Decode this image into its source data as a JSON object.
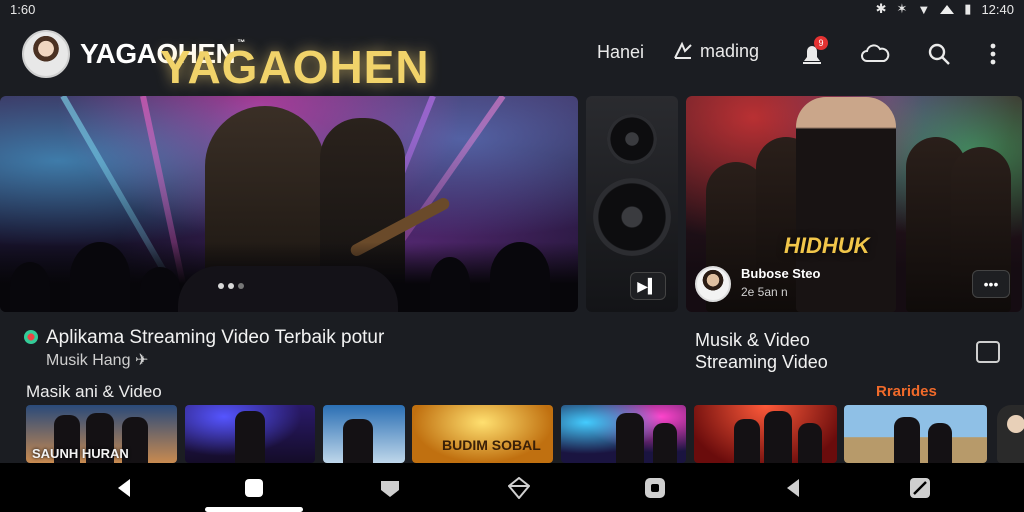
{
  "status_bar": {
    "time": "1:60",
    "clock": "12:40"
  },
  "header": {
    "brand": "YAGAOHEN",
    "trademark": "™",
    "nav_home": "Hanei",
    "nav_trending": "mading",
    "notification_count": "9"
  },
  "hero_main": {
    "title": "YAGAOHEN"
  },
  "hero_side": {
    "title": "HIDHUK",
    "channel_name": "Bubose Steo",
    "channel_sub": "2e 5an n"
  },
  "captions": {
    "main_title": "Aplikama Streaming Video Terbaik potur",
    "main_sub": "Musik Hang",
    "side_line1": "Musik & Video",
    "side_line2": "Streaming Video"
  },
  "row": {
    "title": "Masik ani & Video",
    "link": "Rrarides",
    "thumbs": [
      {
        "caption": "SAUNH HURAN"
      },
      {
        "caption": ""
      },
      {
        "caption": ""
      },
      {
        "caption": "BUDIM SOBAL"
      },
      {
        "caption": ""
      },
      {
        "caption": ""
      },
      {
        "caption": ""
      }
    ]
  },
  "colors": {
    "accent_link": "#f06a2a",
    "title_gold": "#f1d36a",
    "badge_red": "#e53232"
  }
}
